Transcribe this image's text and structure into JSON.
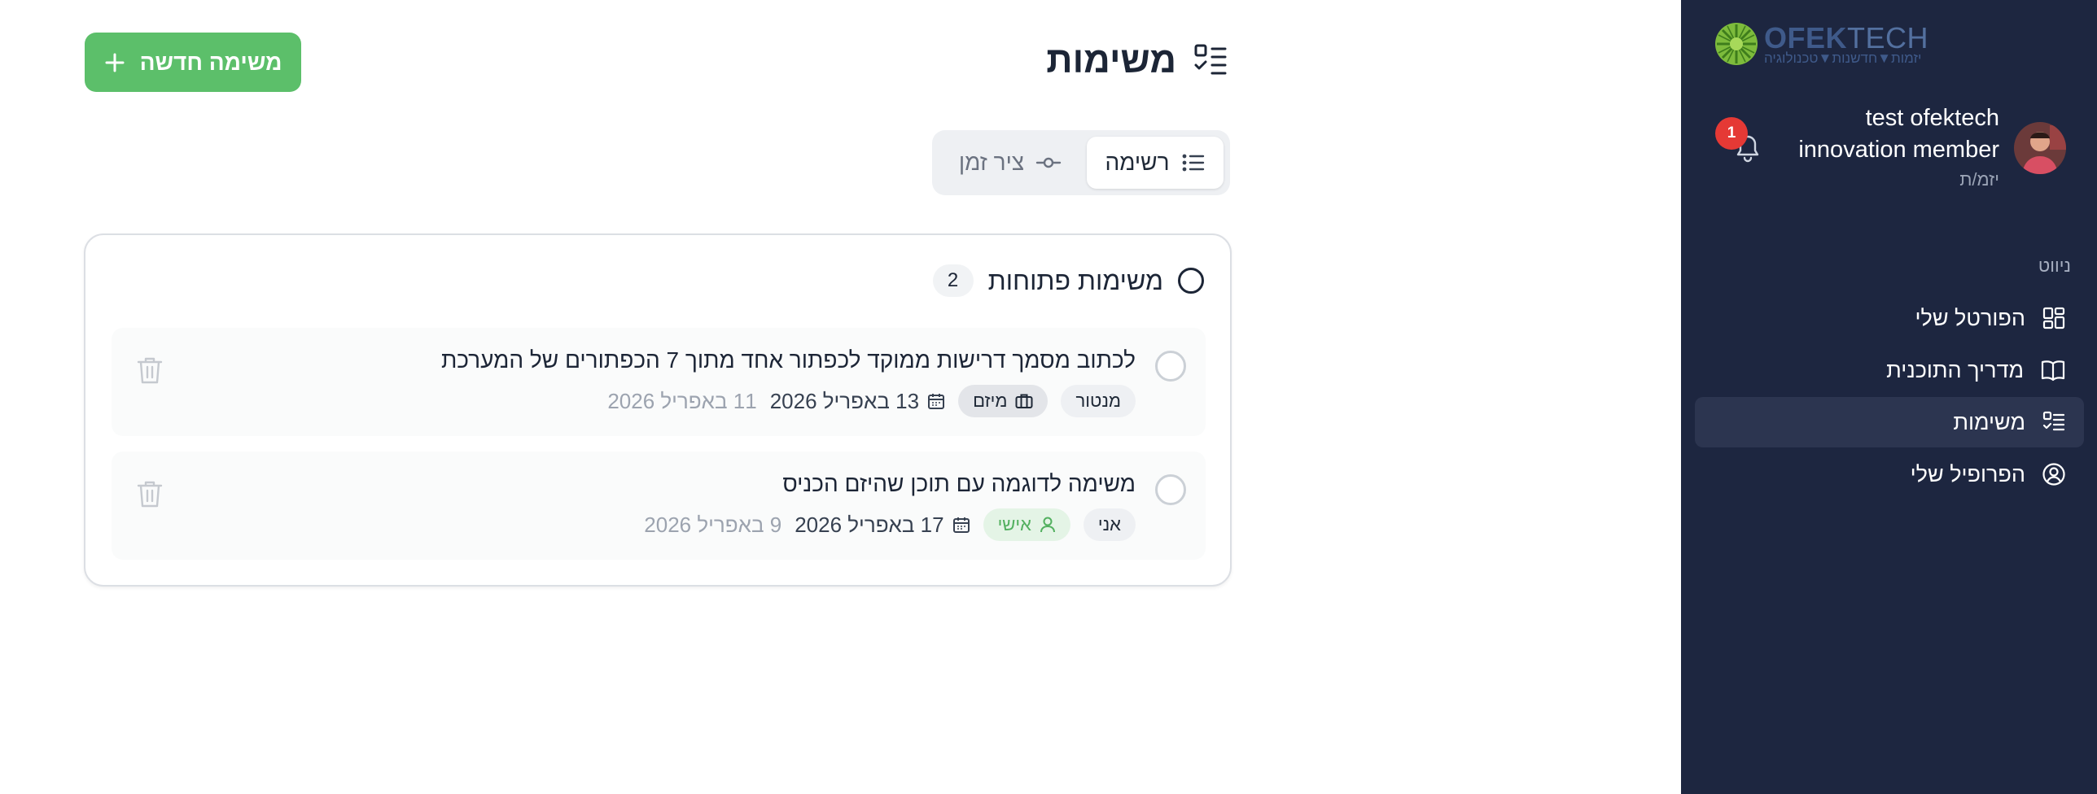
{
  "sidebar": {
    "logo": {
      "brand_main": "OFEK",
      "brand_sub": "TECH",
      "tagline": "יזמות▼חדשנות▼טכנולוגיה"
    },
    "user": {
      "name": "test ofektech innovation member",
      "role": "יזמ/ת",
      "notifications": "1"
    },
    "nav_title": "ניווט",
    "nav": [
      {
        "label": "הפורטל שלי",
        "icon": "dashboard-icon"
      },
      {
        "label": "מדריך התוכנית",
        "icon": "book-icon"
      },
      {
        "label": "משימות",
        "icon": "tasks-icon",
        "active": true
      },
      {
        "label": "הפרופיל שלי",
        "icon": "user-circle-icon"
      }
    ]
  },
  "header": {
    "title": "משימות",
    "new_task_label": "משימה חדשה"
  },
  "view_toggle": {
    "list": "רשימה",
    "timeline": "ציר זמן",
    "selected": "list"
  },
  "open_tasks": {
    "title": "משימות פתוחות",
    "count": "2",
    "tasks": [
      {
        "title": "לכתוב מסמך דרישות ממוקד לכפתור אחד מתוך 7 הכפתורים של המערכת",
        "assignee": "מנטור",
        "tag": "מיזם",
        "due": "13 באפריל 2026",
        "created": "11 באפריל 2026"
      },
      {
        "title": "משימה לדוגמה עם תוכן שהיזם הכניס",
        "assignee": "אני",
        "tag": "אישי",
        "due": "17 באפריל 2026",
        "created": "9 באפריל 2026"
      }
    ]
  },
  "colors": {
    "sidebar_bg": "#1d2640",
    "accent_green": "#5cbf6a",
    "badge_red": "#e53935"
  }
}
